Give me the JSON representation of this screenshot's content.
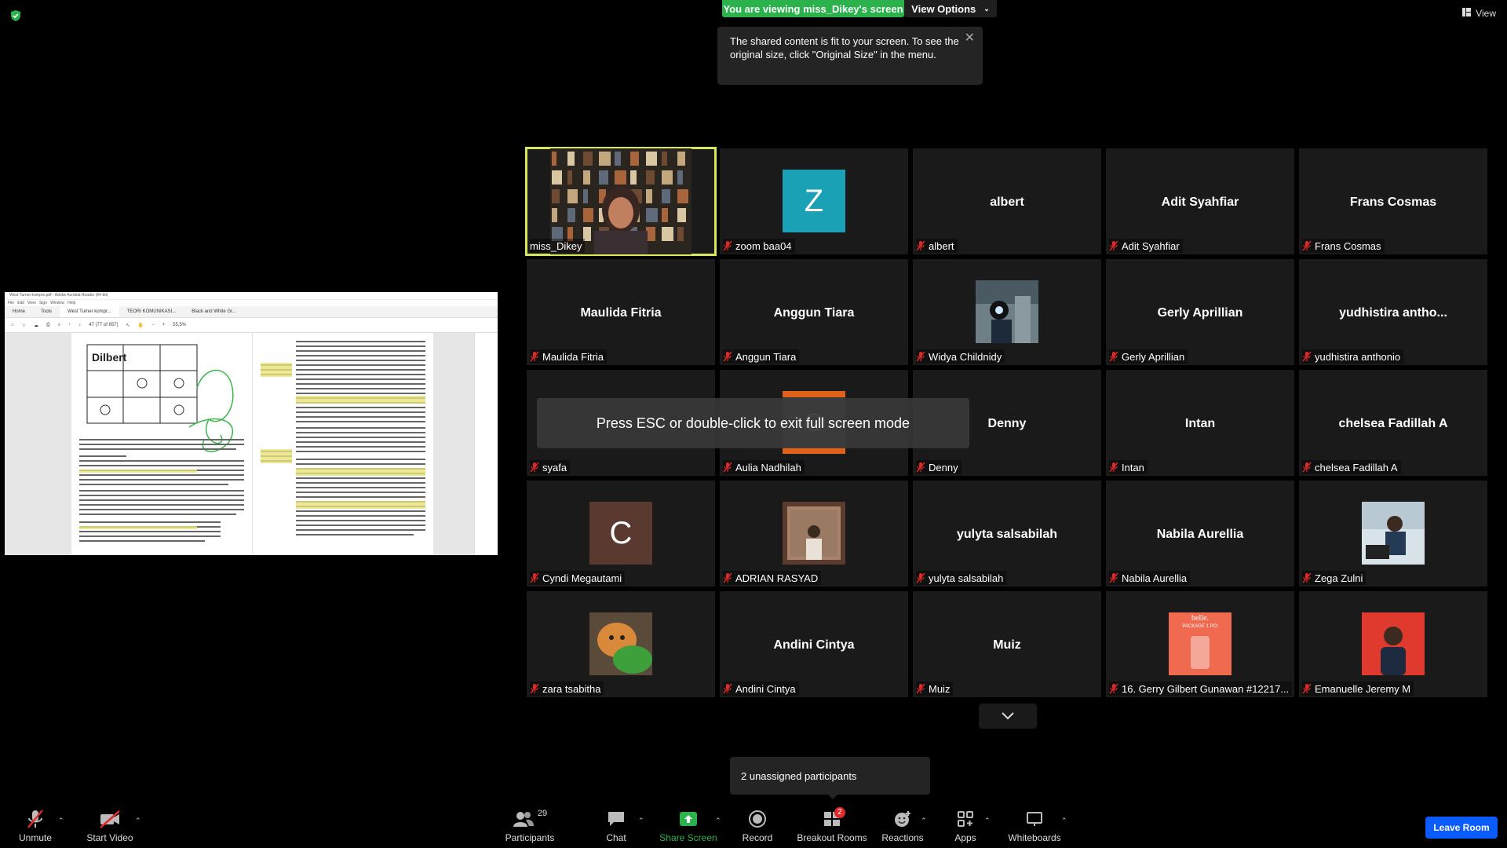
{
  "colors": {
    "banner_green": "#2bb24c",
    "active_outline": "#d8e75a",
    "leave_blue": "#0b5cff",
    "badge_red": "#e02828"
  },
  "banner": {
    "viewing": "You are viewing miss_Dikey's screen",
    "view_options": "View Options"
  },
  "tooltip": {
    "text": "The shared content is fit to your screen. To see the original size, click \"Original Size\" in the menu."
  },
  "top_right": {
    "view_label": "View"
  },
  "shared_screen": {
    "window_title": "West Turner kompre.pdf - Adobe Acrobat Reader (64-bit)",
    "menu": [
      "File",
      "Edit",
      "View",
      "Sign",
      "Window",
      "Help"
    ],
    "tabs": [
      "Home",
      "Tools",
      "West Turner kompr...",
      "TEORI KOMUNIKASI...",
      "Black and White Gr..."
    ],
    "page_indicator": "47 (77 of 657)",
    "zoom": "55,5%"
  },
  "tiles": [
    {
      "name": "miss_Dikey",
      "type": "video",
      "active": true
    },
    {
      "name": "zoom baa04",
      "type": "avatar",
      "letter": "Z",
      "color": "#1aa1b5"
    },
    {
      "name": "albert",
      "type": "name",
      "display": "albert"
    },
    {
      "name": "Adit Syahfiar",
      "type": "name",
      "display": "Adit Syahfiar"
    },
    {
      "name": "Frans Cosmas",
      "type": "name",
      "display": "Frans Cosmas"
    },
    {
      "name": "Maulida Fitria",
      "type": "name",
      "display": "Maulida Fitria"
    },
    {
      "name": "Anggun Tiara",
      "type": "name",
      "display": "Anggun Tiara"
    },
    {
      "name": "Widya Childnidy",
      "type": "photo",
      "photo": "camera-person"
    },
    {
      "name": "Gerly Aprillian",
      "type": "name",
      "display": "Gerly Aprillian"
    },
    {
      "name": "yudhistira anthonio",
      "type": "name",
      "display": "yudhistira  antho..."
    },
    {
      "name": "syafa",
      "type": "name",
      "display": ""
    },
    {
      "name": "Aulia Nadhilah",
      "type": "photo",
      "photo": "orange-frame"
    },
    {
      "name": "Denny",
      "type": "name",
      "display": "Denny"
    },
    {
      "name": "Intan",
      "type": "name",
      "display": "Intan"
    },
    {
      "name": "chelsea Fadillah A",
      "type": "name",
      "display": "chelsea Fadillah A"
    },
    {
      "name": "Cyndi Megautami",
      "type": "avatar",
      "letter": "C",
      "color": "#5a3a30"
    },
    {
      "name": "ADRIAN RASYAD",
      "type": "photo",
      "photo": "man-in-frame"
    },
    {
      "name": "yulyta salsabilah",
      "type": "name",
      "display": "yulyta salsabilah"
    },
    {
      "name": "Nabila Aurellia",
      "type": "name",
      "display": "Nabila Aurellia"
    },
    {
      "name": "Zega Zulni",
      "type": "photo",
      "photo": "man-at-desk"
    },
    {
      "name": "zara tsabitha",
      "type": "photo",
      "photo": "cat"
    },
    {
      "name": "Andini Cintya",
      "type": "name",
      "display": "Andini Cintya"
    },
    {
      "name": "Muiz",
      "type": "name",
      "display": "Muiz"
    },
    {
      "name": "16. Gerry Gilbert Gunawan #12217...",
      "type": "photo",
      "photo": "belle-package"
    },
    {
      "name": "Emanuelle Jeremy M",
      "type": "photo",
      "photo": "man-red-bg"
    }
  ],
  "belle": {
    "line1": "belle.",
    "line2": "PACKAGE 1 PCI"
  },
  "esc_message": "Press ESC or double-click to exit full screen mode",
  "unassigned": "2 unassigned participants",
  "toolbar": {
    "unmute": "Unmute",
    "start_video": "Start Video",
    "participants": "Participants",
    "participants_count": "29",
    "chat": "Chat",
    "share_screen": "Share Screen",
    "record": "Record",
    "breakout_rooms": "Breakout Rooms",
    "breakout_badge": "2",
    "reactions": "Reactions",
    "apps": "Apps",
    "whiteboards": "Whiteboards",
    "leave": "Leave Room"
  }
}
